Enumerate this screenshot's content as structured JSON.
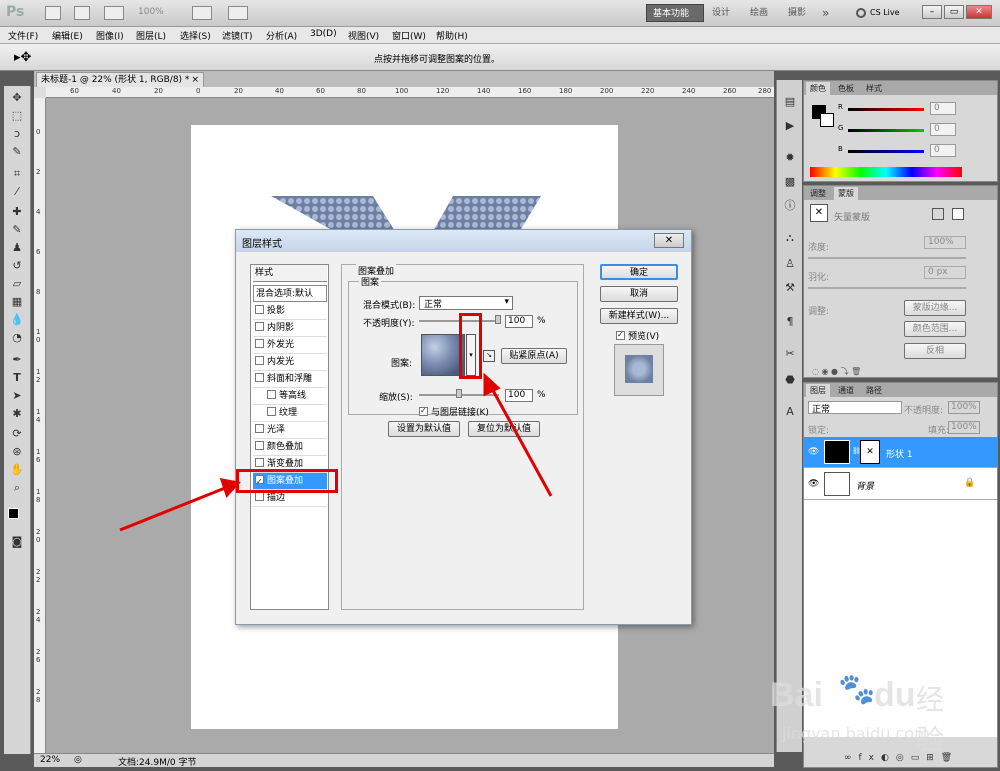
{
  "app": {
    "logo": "Ps",
    "zoom": "100%"
  },
  "workspace": {
    "active": "基本功能",
    "items": [
      "设计",
      "绘画",
      "摄影"
    ],
    "more": "»",
    "cslive": "CS Live"
  },
  "window_buttons": [
    "–",
    "▭",
    "✕"
  ],
  "menu": [
    "文件(F)",
    "编辑(E)",
    "图像(I)",
    "图层(L)",
    "选择(S)",
    "滤镜(T)",
    "分析(A)",
    "3D(D)",
    "视图(V)",
    "窗口(W)",
    "帮助(H)"
  ],
  "options_hint": "点按并拖移可调整图案的位置。",
  "doc_tab": {
    "title": "未标题-1 @ 22% (形状 1, RGB/8) *",
    "close": "×"
  },
  "ruler_h": [
    "60",
    "40",
    "20",
    "0",
    "20",
    "40",
    "60",
    "80",
    "100",
    "120",
    "140",
    "160",
    "180",
    "200",
    "220",
    "240",
    "260",
    "280"
  ],
  "ruler_v": [
    "0",
    "2",
    "4",
    "6",
    "8",
    "1 0",
    "1 2",
    "1 4",
    "1 6",
    "1 8",
    "2 0",
    "2 2",
    "2 4",
    "2 6",
    "2 8"
  ],
  "status": {
    "zoom": "22%",
    "doc": "文档:24.9M/0 字节"
  },
  "dialog": {
    "title": "图层样式",
    "styles_header": "样式",
    "blend_default": "混合选项:默认",
    "styles": [
      {
        "label": "投影",
        "checked": false,
        "indent": false
      },
      {
        "label": "内阴影",
        "checked": false,
        "indent": false
      },
      {
        "label": "外发光",
        "checked": false,
        "indent": false
      },
      {
        "label": "内发光",
        "checked": false,
        "indent": false
      },
      {
        "label": "斜面和浮雕",
        "checked": false,
        "indent": false
      },
      {
        "label": "等高线",
        "checked": false,
        "indent": true
      },
      {
        "label": "纹理",
        "checked": false,
        "indent": true
      },
      {
        "label": "光泽",
        "checked": false,
        "indent": false
      },
      {
        "label": "颜色叠加",
        "checked": false,
        "indent": false
      },
      {
        "label": "渐变叠加",
        "checked": false,
        "indent": false
      },
      {
        "label": "图案叠加",
        "checked": true,
        "indent": false
      },
      {
        "label": "描边",
        "checked": false,
        "indent": false
      }
    ],
    "section_title": "图案叠加",
    "group_title": "图案",
    "blend_mode_label": "混合模式(B):",
    "blend_mode_value": "正常",
    "opacity_label": "不透明度(Y):",
    "opacity_value": "100",
    "percent": "%",
    "pattern_label": "图案:",
    "snap_origin": "贴紧原点(A)",
    "scale_label": "缩放(S):",
    "scale_value": "100",
    "link_label": "与图层链接(K)",
    "link_checked": true,
    "set_default": "设置为默认值",
    "reset_default": "复位为默认值",
    "ok": "确定",
    "cancel": "取消",
    "new_style": "新建样式(W)...",
    "preview": "预览(V)",
    "preview_checked": true
  },
  "color_panel": {
    "tabs": [
      "颜色",
      "色板",
      "样式"
    ],
    "r": "0",
    "g": "0",
    "b": "0",
    "labels": [
      "R",
      "G",
      "B"
    ]
  },
  "adjust_panel": {
    "tabs": [
      "调整",
      "蒙版"
    ],
    "title": "矢量蒙版",
    "density_label": "浓度:",
    "density_value": "100%",
    "feather_label": "羽化:",
    "feather_value": "0 px",
    "refine_label": "调整:",
    "buttons": [
      "蒙版边缘...",
      "颜色范围...",
      "反相"
    ]
  },
  "layers_panel": {
    "tabs": [
      "图层",
      "通道",
      "路径"
    ],
    "blend": "正常",
    "opacity_label": "不透明度:",
    "opacity": "100%",
    "lock_label": "锁定:",
    "fill_label": "填充:",
    "fill": "100%",
    "layers": [
      {
        "name": "形状 1",
        "selected": true
      },
      {
        "name": "背景",
        "selected": false
      }
    ],
    "footer_icons": [
      "∞",
      "fx",
      "◐",
      "◎",
      "▭",
      "⊞",
      "🗑"
    ]
  },
  "watermark": {
    "brand": "Bai",
    "brand2": "du",
    "cn": "经验",
    "url": "jingyan.baidu.com"
  },
  "colors": {
    "accent_blue": "#3a8ee6",
    "annotation_red": "#e00000",
    "selection": "#3399ff"
  }
}
